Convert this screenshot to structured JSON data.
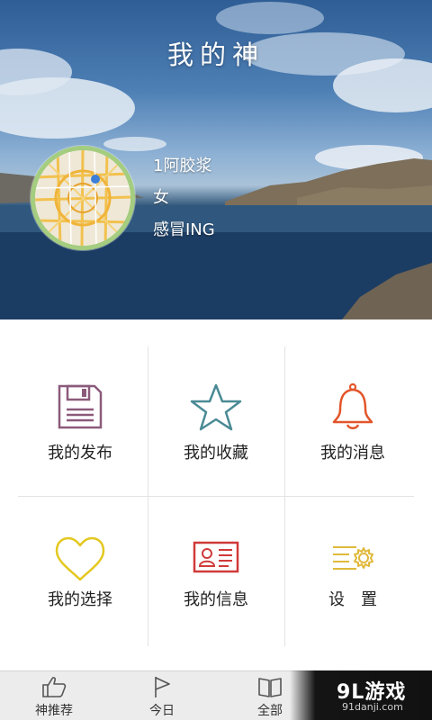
{
  "header": {
    "title": "我的神"
  },
  "profile": {
    "name": "1阿胶浆",
    "gender": "女",
    "status": "感冒ING"
  },
  "menu": [
    {
      "label": "我的发布",
      "icon": "floppy-disk-icon",
      "color": "#8b5a7a"
    },
    {
      "label": "我的收藏",
      "icon": "star-icon",
      "color": "#4a8a95"
    },
    {
      "label": "我的消息",
      "icon": "bell-icon",
      "color": "#e2552a"
    },
    {
      "label": "我的选择",
      "icon": "heart-icon",
      "color": "#e3c820"
    },
    {
      "label": "我的信息",
      "icon": "id-card-icon",
      "color": "#d03a3a"
    },
    {
      "label": "设　置",
      "icon": "settings-gear-icon",
      "color": "#e0b93a"
    }
  ],
  "tabbar": {
    "tabs": [
      {
        "label": "神推荐",
        "icon": "thumbs-up-icon"
      },
      {
        "label": "今日",
        "icon": "flag-icon"
      },
      {
        "label": "全部",
        "icon": "book-icon"
      }
    ]
  },
  "watermark": {
    "brand": "9L游戏",
    "url": "91danji.com"
  }
}
